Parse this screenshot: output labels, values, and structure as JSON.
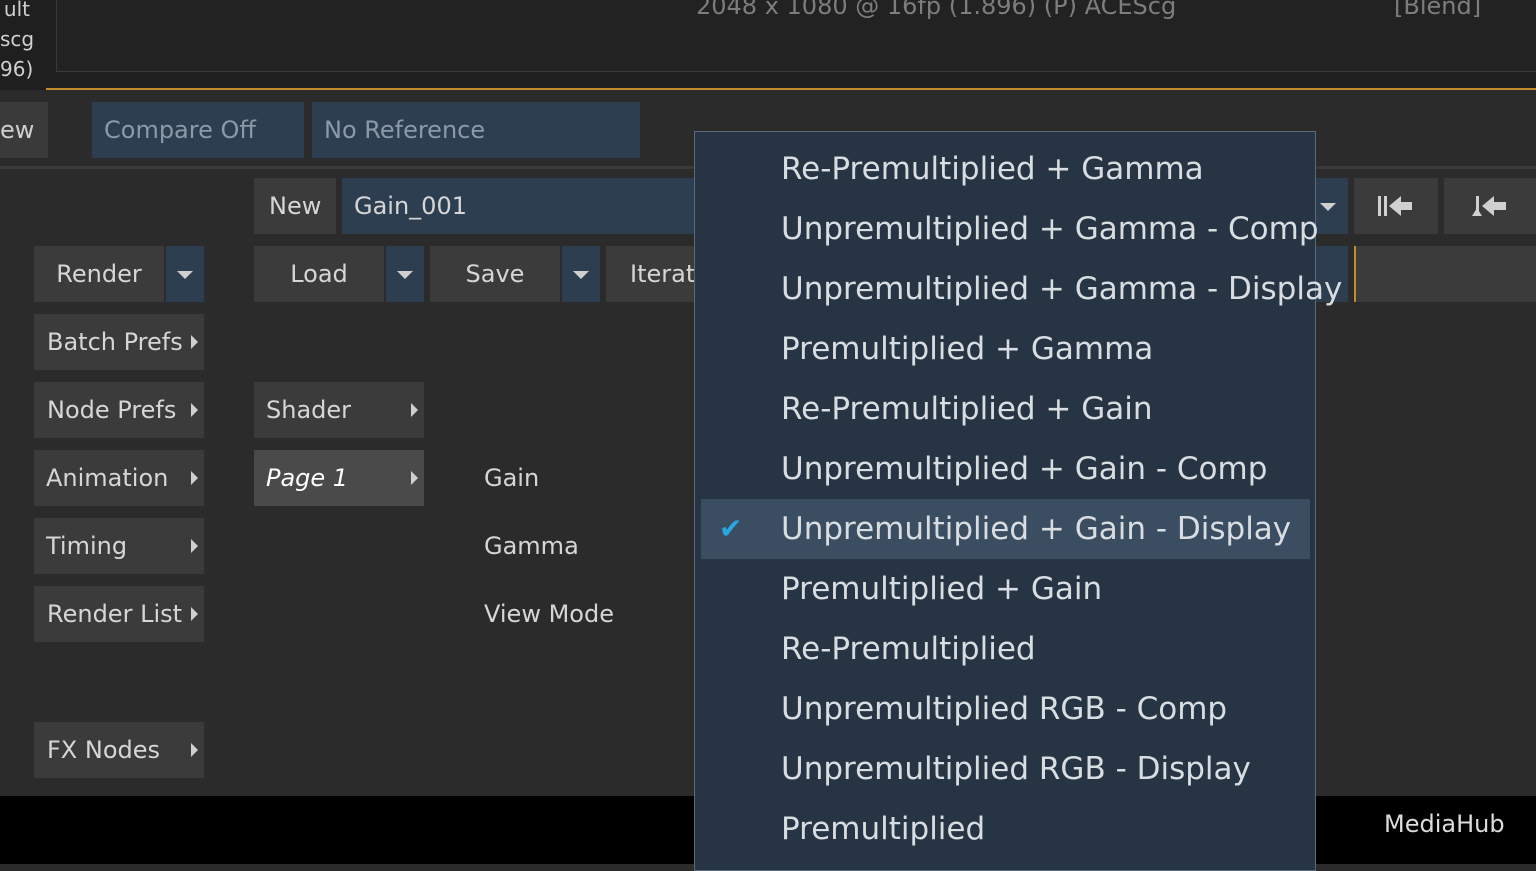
{
  "viewer": {
    "left_lines": [
      "ult",
      "scg",
      "96)"
    ],
    "resolution": "2048 x 1080 @ 16fp (1.896) (P) ACEScg",
    "blend": "[Blend]"
  },
  "compare_bar": {
    "view_label": "ew",
    "compare_label": "Compare Off",
    "reference_label": "No Reference"
  },
  "setup_bar": {
    "new_label": "New",
    "name_value": "Gain_001",
    "load_label": "Load",
    "save_label": "Save",
    "iterate_label": "Iterat"
  },
  "left_menu": {
    "render_label": "Render",
    "items": [
      "Batch Prefs",
      "Node Prefs",
      "Animation",
      "Timing",
      "Render List",
      "FX Nodes"
    ]
  },
  "pages": {
    "shader_label": "Shader",
    "page1_label": "Page 1"
  },
  "params": {
    "gain_label": "Gain",
    "gamma_label": "Gamma",
    "view_mode_label": "View Mode"
  },
  "view_mode_dropdown": {
    "selected": "Unpremultiplied + Gain - Display",
    "options": [
      "Re-Premultiplied + Gamma",
      "Unpremultiplied + Gamma - Comp",
      "Unpremultiplied + Gamma - Display",
      "Premultiplied + Gamma",
      "Re-Premultiplied + Gain",
      "Unpremultiplied + Gain - Comp",
      "Unpremultiplied + Gain - Display",
      "Premultiplied + Gain",
      "Re-Premultiplied",
      "Unpremultiplied RGB - Comp",
      "Unpremultiplied RGB - Display",
      "Premultiplied"
    ],
    "check_icon": "checkmark-icon"
  },
  "footer": {
    "mediahub_label": "MediaHub"
  },
  "colors": {
    "accent": "#2aa7e0",
    "viewer_border": "#c58a2b",
    "menu_bg": "#263444",
    "selected_bg": "#3a4d61"
  }
}
